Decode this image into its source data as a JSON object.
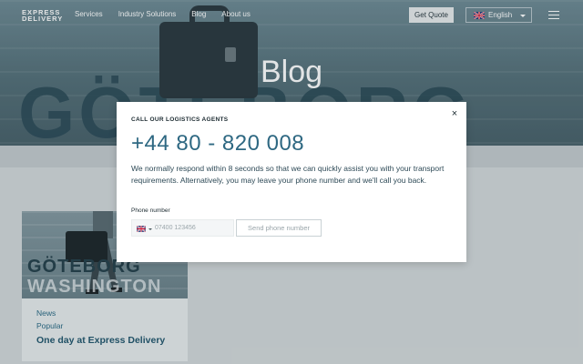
{
  "header": {
    "logo_line1": "EXPRESS",
    "logo_line2": "DELIVERY",
    "nav": [
      "Services",
      "Industry Solutions",
      "Blog",
      "About us"
    ],
    "quote_label": "Get Quote",
    "language": "English"
  },
  "hero": {
    "title": "Blog",
    "background_text": "GÖTEBORG"
  },
  "card": {
    "image_text_line1": "GÖTEBORG",
    "image_text_line2": "WASHINGTON",
    "tag1": "News",
    "tag2": "Popular",
    "title": "One day at Express Delivery"
  },
  "modal": {
    "heading": "CALL OUR LOGISTICS AGENTS",
    "phone": "+44 80 - 820 008",
    "description": "We normally respond within 8 seconds so that we can quickly assist you with your transport requirements. Alternatively, you may leave your phone number and we'll call you back.",
    "field_label": "Phone number",
    "phone_placeholder": "07400 123456",
    "phone_value": "",
    "send_label": "Send phone number",
    "close_symbol": "×"
  },
  "colors": {
    "accent_blue": "#2e6882",
    "card_text": "#2c6b86",
    "hero_tint": "#557079"
  },
  "icons": [
    "uk-flag-icon",
    "chevron-down-icon",
    "hamburger-menu-icon",
    "close-icon"
  ]
}
